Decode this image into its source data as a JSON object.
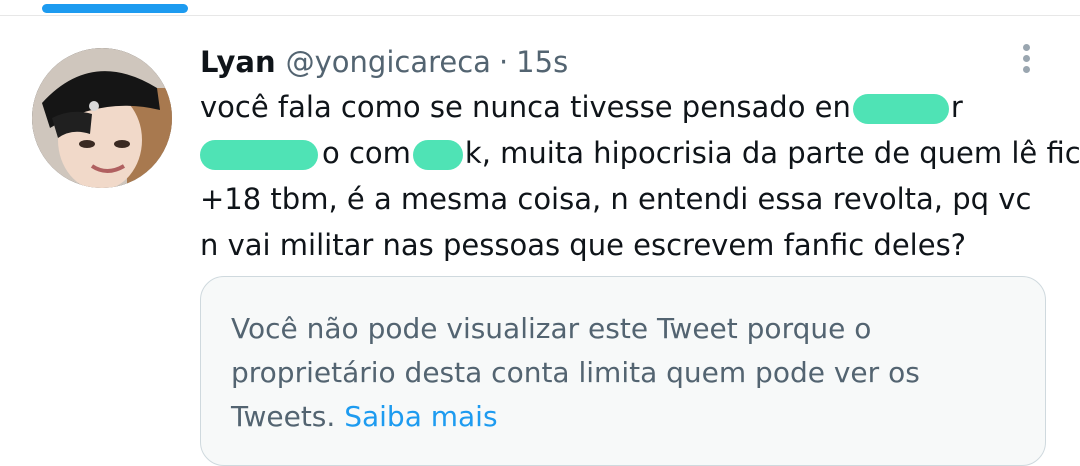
{
  "tweet": {
    "author": {
      "display_name": "Lyan",
      "handle": "@yongicareca"
    },
    "separator": "·",
    "timestamp": "15s",
    "text_lines": [
      {
        "before": "você fala como se nunca tivesse pensado en",
        "after": "r"
      },
      {
        "after": "o com",
        "after2": "k, muita hipocrisia da parte de quem lê fic"
      },
      {
        "text": "+18 tbm, é a mesma coisa, n entendi essa revolta, pq vc"
      },
      {
        "text": "n vai militar nas pessoas que escrevem fanfic deles?"
      }
    ],
    "quoted": {
      "lines": [
        "Você não pode visualizar este Tweet porque o",
        "proprietário desta conta limita quem pode ver os",
        "Tweets."
      ],
      "link_label": "Saiba mais"
    }
  },
  "colors": {
    "accent": "#1d9bf0",
    "redaction": "#4fe3b5",
    "secondary_text": "#536471"
  },
  "icons": {
    "more": "more-vertical-icon"
  }
}
